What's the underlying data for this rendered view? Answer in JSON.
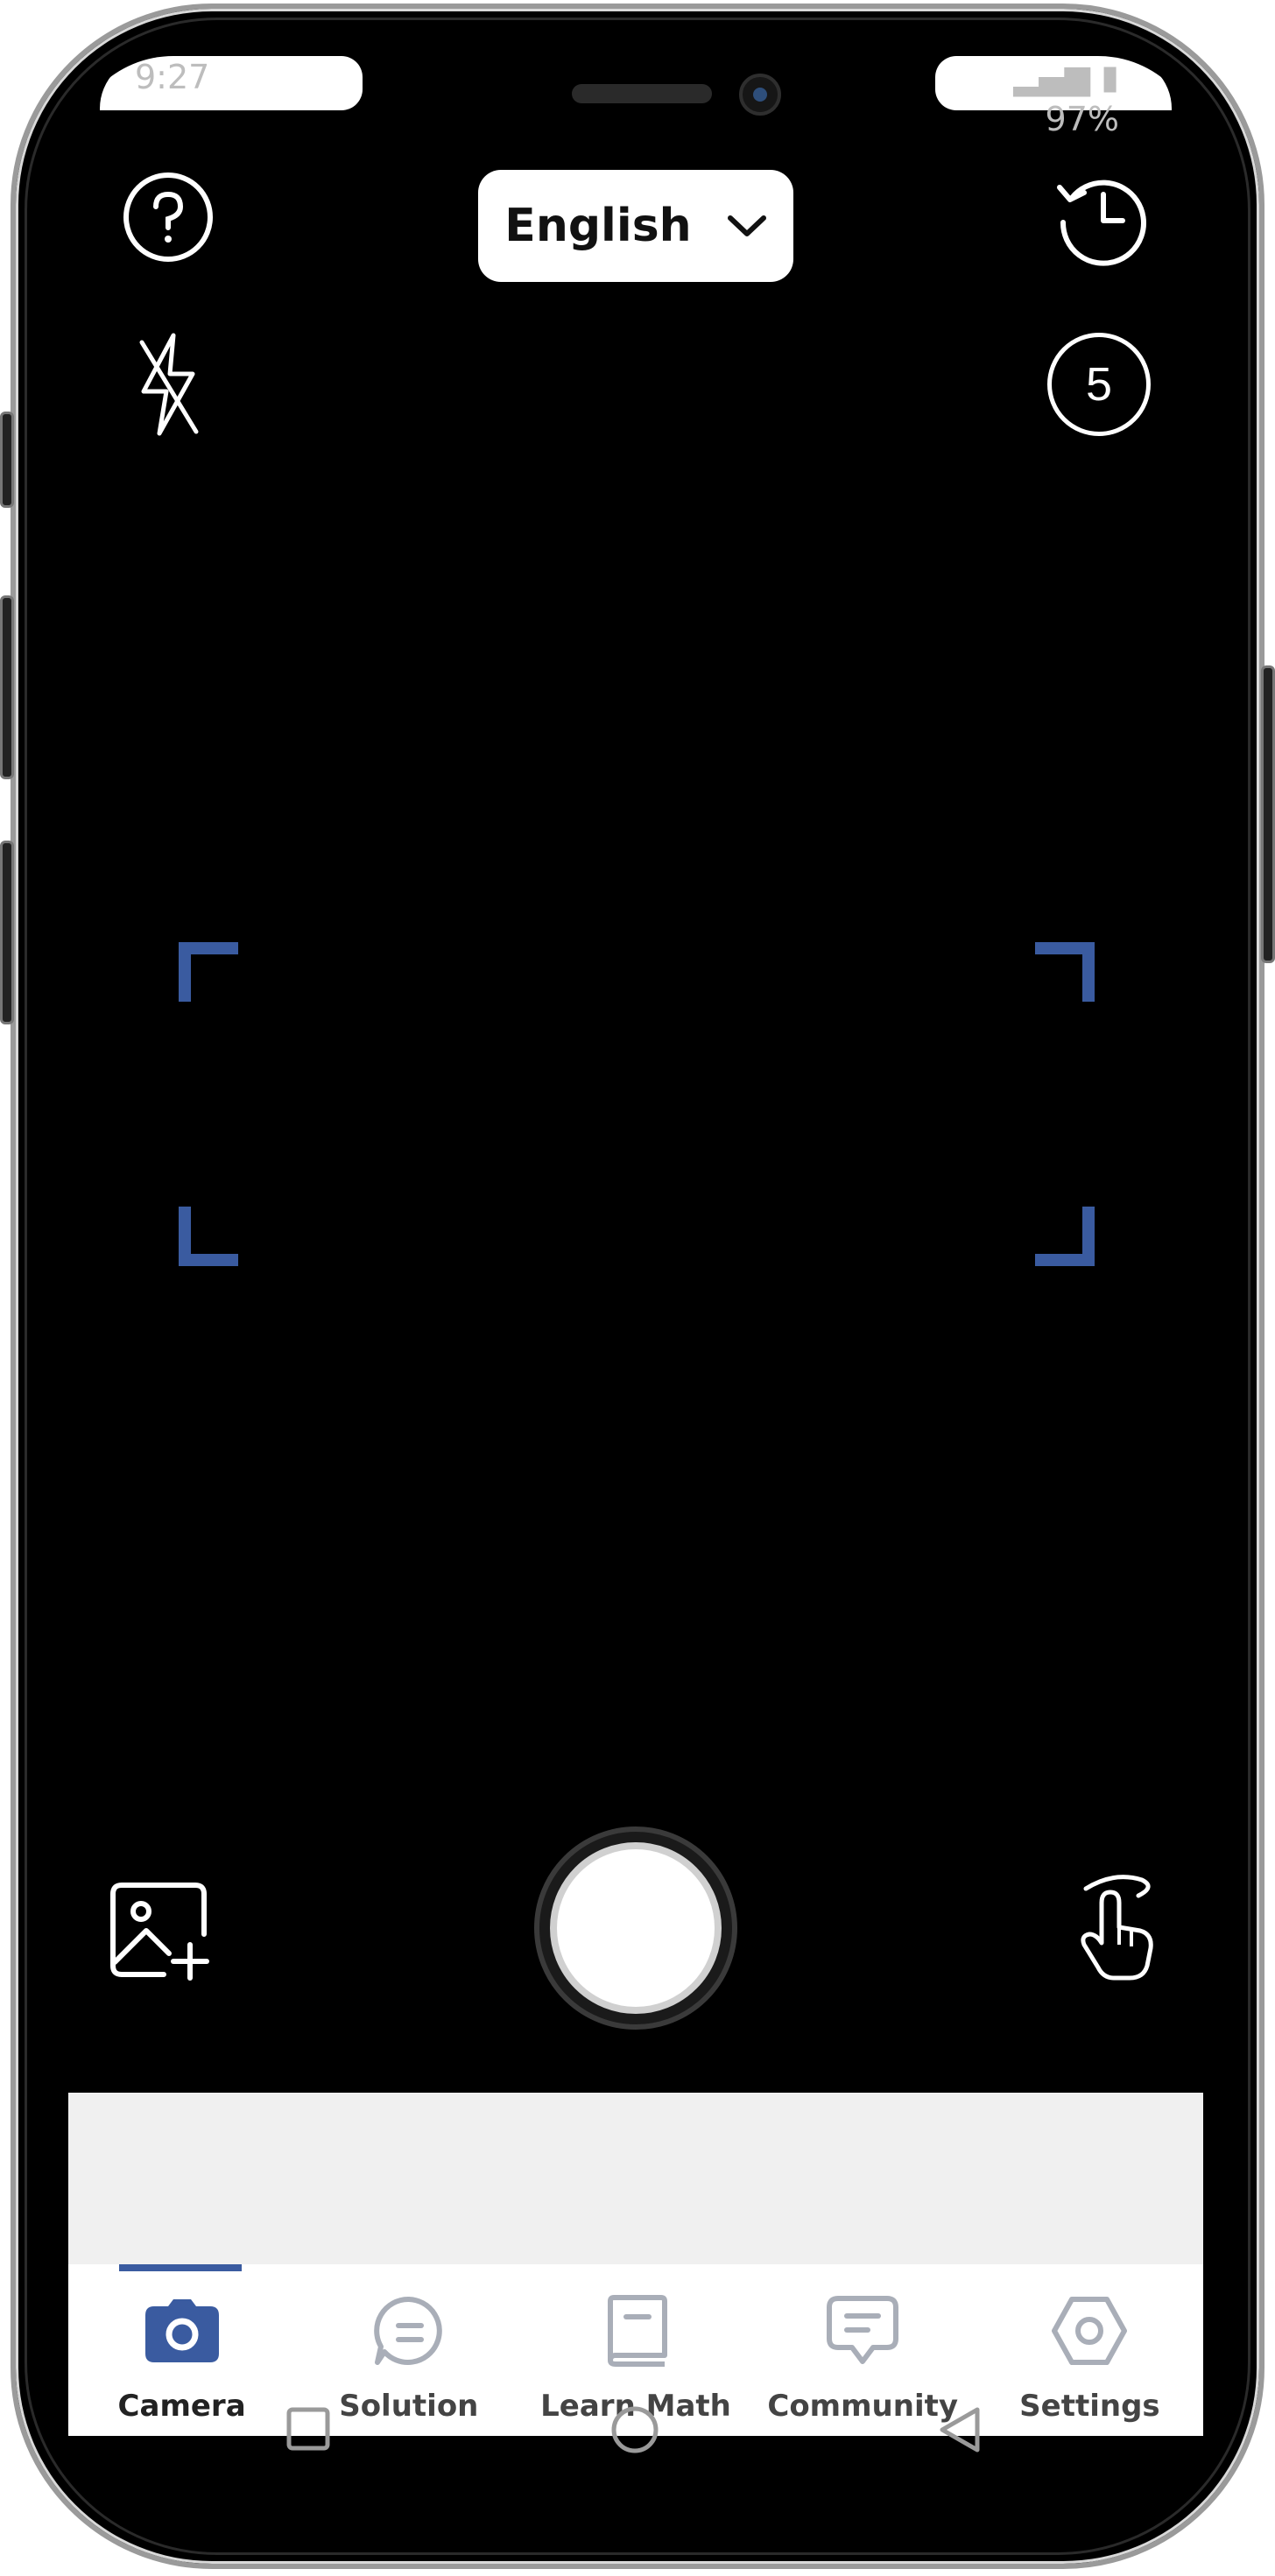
{
  "status": {
    "time": "9:27",
    "battery": "97%"
  },
  "header": {
    "language": "English"
  },
  "camera": {
    "queue_count": "5"
  },
  "tabs": [
    {
      "id": "camera",
      "label": "Camera",
      "active": true
    },
    {
      "id": "solution",
      "label": "Solution",
      "active": false
    },
    {
      "id": "learn",
      "label": "Learn Math",
      "active": false
    },
    {
      "id": "community",
      "label": "Community",
      "active": false
    },
    {
      "id": "settings",
      "label": "Settings",
      "active": false
    }
  ],
  "colors": {
    "accent": "#3a5ba0",
    "inactive_icon": "#a9aeb8"
  },
  "icons": {
    "help": "question-circle-icon",
    "history": "history-clock-icon",
    "flash": "flash-off-icon",
    "gallery": "image-add-icon",
    "gesture": "hand-swipe-icon"
  }
}
